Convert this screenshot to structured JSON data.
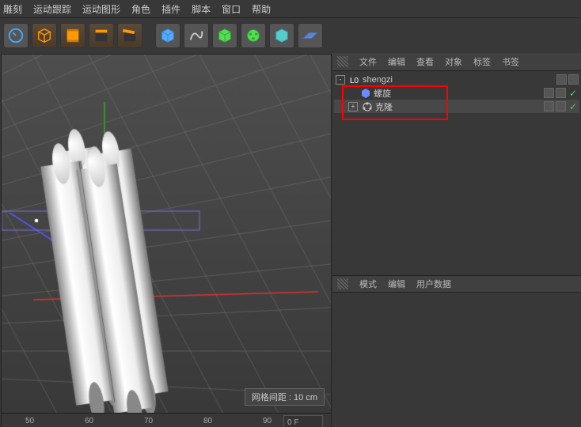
{
  "menu": {
    "items": [
      "雕刻",
      "运动跟踪",
      "运动图形",
      "角色",
      "插件",
      "脚本",
      "窗口",
      "帮助"
    ]
  },
  "toolbar": {
    "icons": [
      "redo-icon",
      "cube-orange-icon",
      "film-orange-icon",
      "clapper1-icon",
      "clapper2-icon",
      "cube-blue-icon",
      "spline-icon",
      "cube-green1-icon",
      "cube-green2-icon",
      "cube-teal-icon",
      "floor-icon"
    ]
  },
  "viewport": {
    "grid_label": "网格间距 : 10 cm"
  },
  "ruler": {
    "ticks": [
      "50",
      "60",
      "70",
      "80",
      "90"
    ],
    "temp": "0 F"
  },
  "obj_panel": {
    "tabs": [
      "文件",
      "编辑",
      "查看",
      "对象",
      "标签",
      "书签"
    ],
    "items": [
      {
        "exp": "-",
        "icon": "null",
        "name": "shengzi",
        "checks": false,
        "indent": 0,
        "iconColor": "#fff"
      },
      {
        "exp": "",
        "icon": "helix",
        "name": "螺旋",
        "checks": true,
        "indent": 1,
        "iconColor": "#6a8cff"
      },
      {
        "exp": "+",
        "icon": "cloner",
        "name": "克隆",
        "checks": true,
        "indent": 1,
        "iconColor": "#7dd87d"
      }
    ]
  },
  "attr_panel": {
    "tabs": [
      "模式",
      "编辑",
      "用户数据"
    ]
  }
}
